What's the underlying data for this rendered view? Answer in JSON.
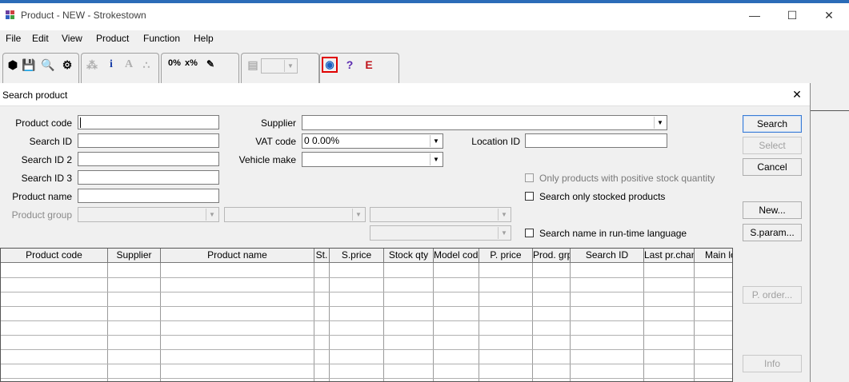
{
  "window": {
    "title": "Product - NEW - Strokestown",
    "minimize": "—",
    "maximize": "☐",
    "close": "✕"
  },
  "menu": [
    "File",
    "Edit",
    "View",
    "Product",
    "Function",
    "Help"
  ],
  "toolbar": {
    "percent_label": "0%",
    "xpercent_label": "x%",
    "info_label": "i",
    "font_label": "A",
    "help_label": "?",
    "e_label": "E"
  },
  "dialog": {
    "title": "Search product",
    "close": "✕",
    "labels": {
      "product_code": "Product code",
      "search_id": "Search ID",
      "search_id2": "Search ID 2",
      "search_id3": "Search ID 3",
      "product_name": "Product name",
      "product_group": "Product group",
      "supplier": "Supplier",
      "vat_code": "VAT code",
      "vehicle_make": "Vehicle make",
      "location_id": "Location ID"
    },
    "values": {
      "vat_code": "0  0.00%"
    },
    "checkboxes": {
      "positive_stock": "Only products with positive stock quantity",
      "stocked_only": "Search only stocked products",
      "runtime_language": "Search name in run-time language"
    },
    "buttons": {
      "search": "Search",
      "select": "Select",
      "cancel": "Cancel",
      "new": "New...",
      "sparam": "S.param...",
      "porder": "P. order...",
      "info": "Info"
    }
  },
  "grid": {
    "columns": [
      "Product code",
      "Supplier",
      "Product name",
      "St.",
      "S.price",
      "Stock qty",
      "Model code",
      "P. price",
      "Prod. grp",
      "Search ID",
      "Last pr.change",
      "Main lo"
    ]
  },
  "colors": {
    "accent_border": "#3a7bd5",
    "highlight_red": "#e00000",
    "e_icon": "#c0141c"
  }
}
